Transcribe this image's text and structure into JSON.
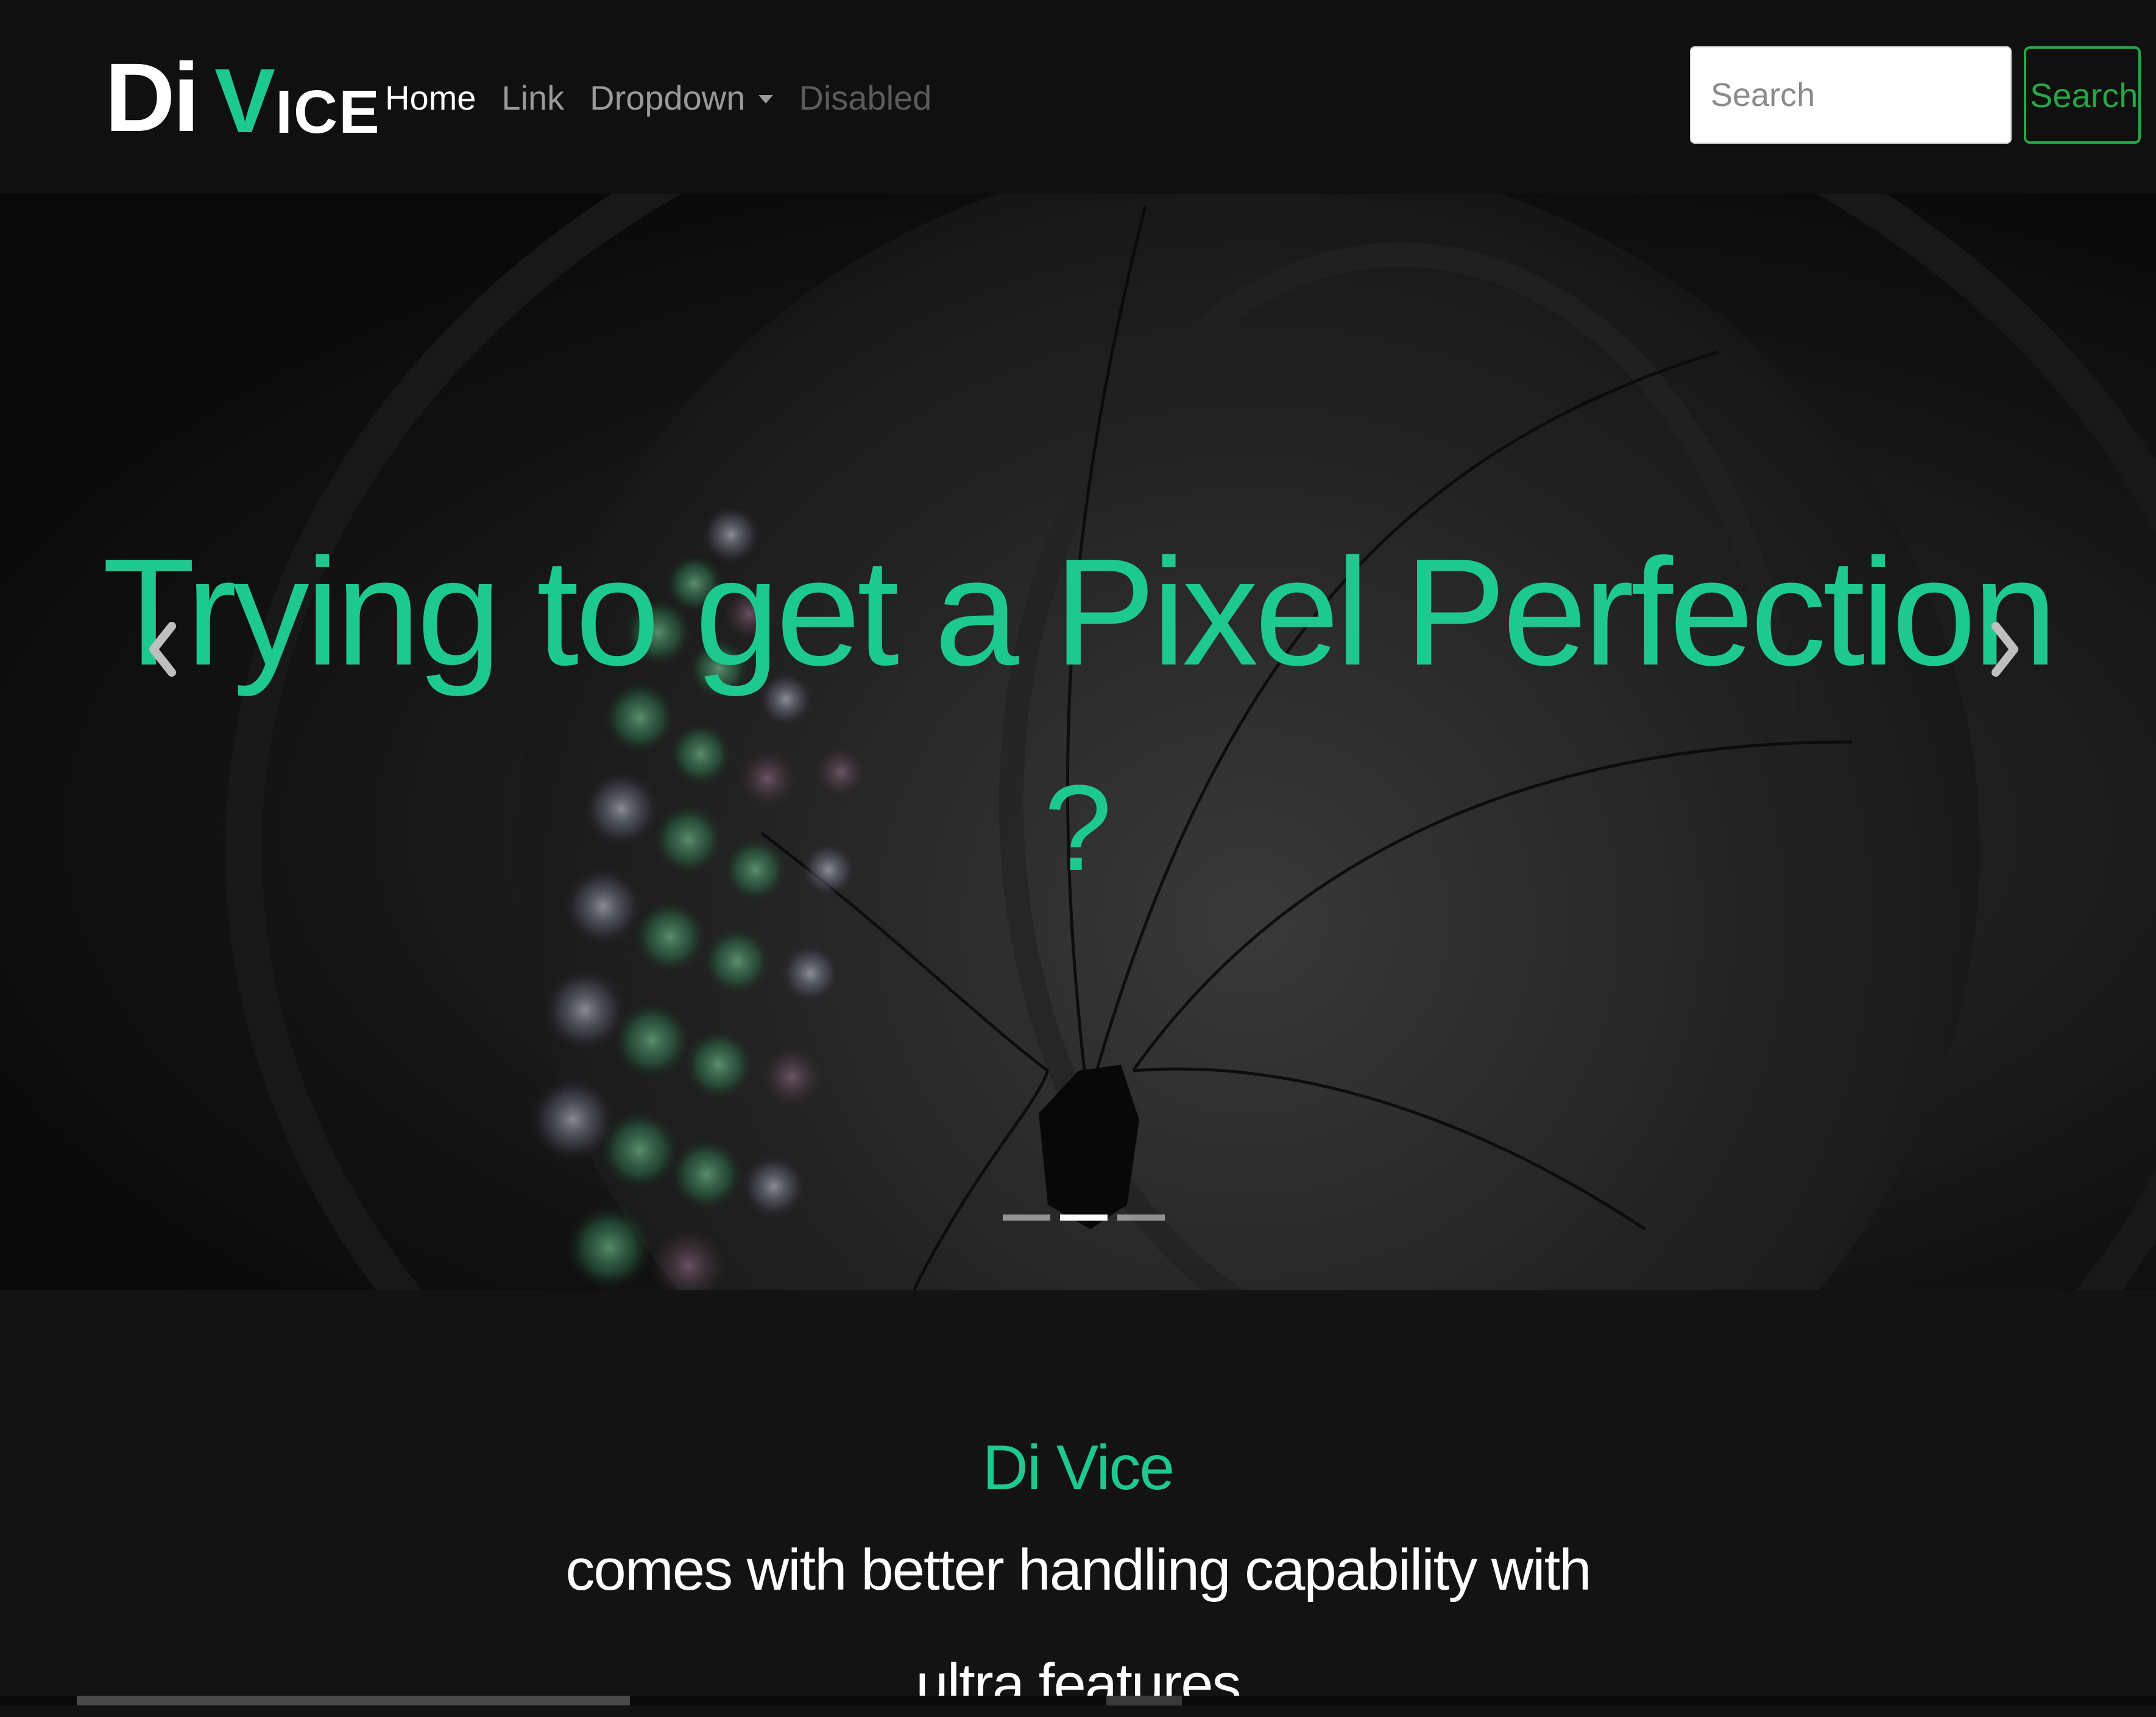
{
  "brand": {
    "part1": "Di",
    "part2": "V",
    "part3": "ICE"
  },
  "nav": {
    "items": [
      {
        "label": "Home",
        "state": "active"
      },
      {
        "label": "Link",
        "state": "normal"
      },
      {
        "label": "Dropdown",
        "state": "dropdown"
      },
      {
        "label": "Disabled",
        "state": "disabled"
      }
    ]
  },
  "search": {
    "placeholder": "Search",
    "value": "",
    "button_label": "Search"
  },
  "hero": {
    "title": "Trying to get a Pixel Perfection",
    "question": "?",
    "prev_icon": "chevron-left-icon",
    "next_icon": "chevron-right-icon",
    "indicator_count": 3,
    "active_indicator": 1
  },
  "about": {
    "title": "Di Vice",
    "line1": "comes with better handling capability with",
    "line2": "ultra features"
  },
  "colors": {
    "accent": "#1ec98f",
    "search_button": "#28a745",
    "navbar_bg": "#101010",
    "page_bg": "#131313"
  }
}
